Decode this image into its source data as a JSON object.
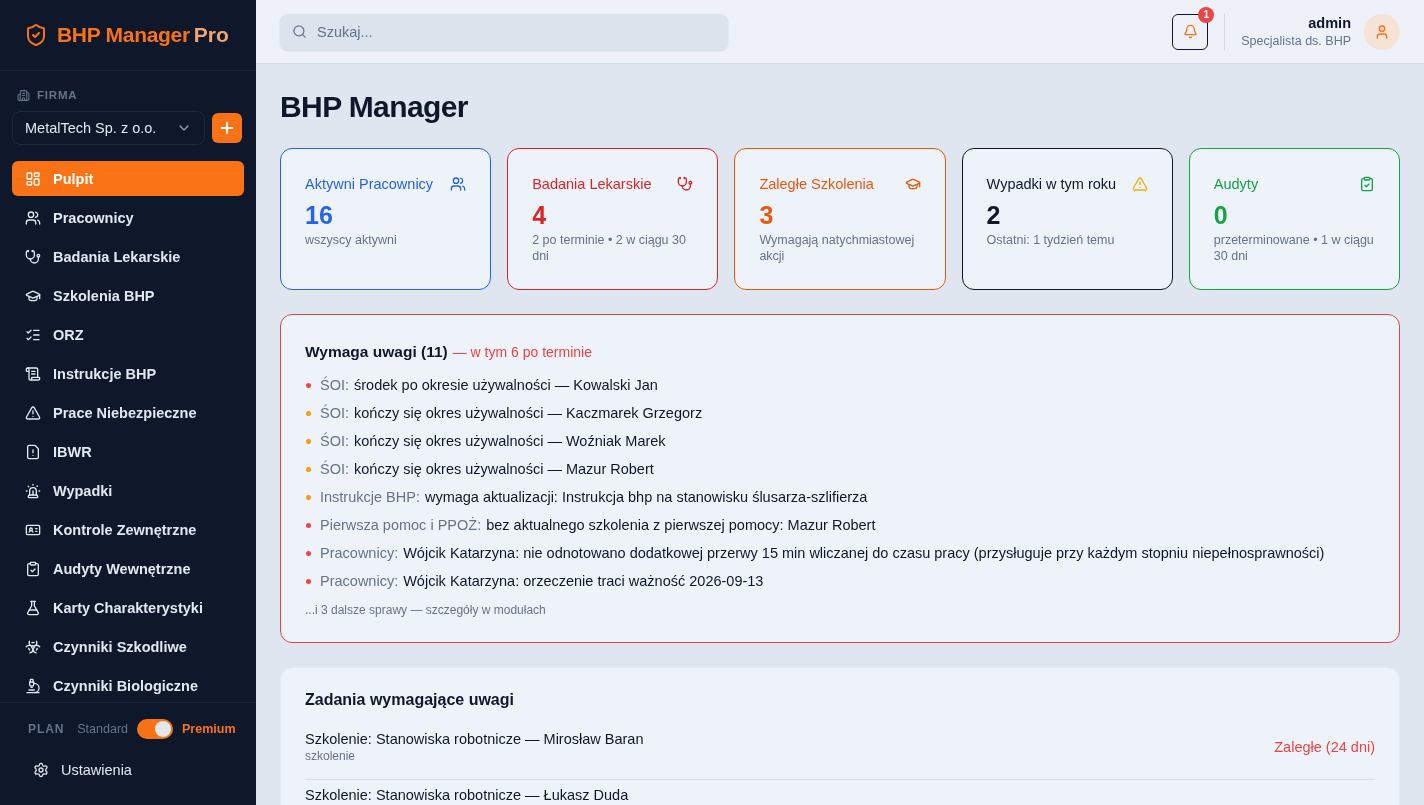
{
  "sidebar": {
    "logo": {
      "name": "BHP Manager",
      "badge": "Pro"
    },
    "company": {
      "label": "FIRMA",
      "value": "MetalTech Sp. z o.o."
    },
    "nav": [
      {
        "label": "Pulpit",
        "selected": true
      },
      {
        "label": "Pracownicy",
        "selected": false
      },
      {
        "label": "Badania Lekarskie",
        "selected": false
      },
      {
        "label": "Szkolenia BHP",
        "selected": false
      },
      {
        "label": "ORZ",
        "selected": false
      },
      {
        "label": "Instrukcje BHP",
        "selected": false
      },
      {
        "label": "Prace Niebezpieczne",
        "selected": false
      },
      {
        "label": "IBWR",
        "selected": false
      },
      {
        "label": "Wypadki",
        "selected": false
      },
      {
        "label": "Kontrole Zewnętrzne",
        "selected": false
      },
      {
        "label": "Audyty Wewnętrzne",
        "selected": false
      },
      {
        "label": "Karty Charakterystyki",
        "selected": false
      },
      {
        "label": "Czynniki Szkodliwe",
        "selected": false
      },
      {
        "label": "Czynniki Biologiczne",
        "selected": false
      }
    ],
    "plan": {
      "label": "PLAN",
      "options": [
        "Standard",
        "Premium"
      ],
      "on": true
    },
    "settings": {
      "label": "Ustawienia"
    }
  },
  "topbar": {
    "search": {
      "placeholder": "Szukaj..."
    },
    "notifications": {
      "count": "1"
    },
    "user": {
      "name": "admin",
      "role": "Specjalista ds. BHP"
    }
  },
  "page_title": "BHP Manager",
  "cards": [
    {
      "title": "Aktywni Pracownicy",
      "value": "16",
      "note": "wszyscy aktywni",
      "color": "#2563eb"
    },
    {
      "title": "Badania Lekarskie",
      "value": "4",
      "note": "2 po terminie • 2 w ciągu 30 dni",
      "color": "#dc2626"
    },
    {
      "title": "Zaległe Szkolenia",
      "value": "3",
      "note": "Wymagają natychmiastowej akcji",
      "color": "#ea580c"
    },
    {
      "title": "Wypadki w tym roku",
      "value": "2",
      "note": "Ostatni: 1 tydzień temu",
      "color": "#0f172a"
    },
    {
      "title": "Audyty",
      "value": "0",
      "note": "przeterminowane • 1 w ciągu 30 dni",
      "color": "#16a34a"
    }
  ],
  "attention": {
    "title": "Wymaga uwagi (11)",
    "subtitle": "— w tym 6 po terminie",
    "items": [
      {
        "category": "ŚOI:",
        "text": "środek po okresie używalności — Kowalski Jan",
        "color": "#ef4444"
      },
      {
        "category": "ŚOI:",
        "text": "kończy się okres używalności — Kaczmarek Grzegorz",
        "color": "#f59e0b"
      },
      {
        "category": "ŚOI:",
        "text": "kończy się okres używalności — Woźniak Marek",
        "color": "#f59e0b"
      },
      {
        "category": "ŚOI:",
        "text": "kończy się okres używalności — Mazur Robert",
        "color": "#f59e0b"
      },
      {
        "category": "Instrukcje BHP:",
        "text": "wymaga aktualizacji: Instrukcja bhp na stanowisku ślusarza-szlifierza",
        "color": "#f59e0b"
      },
      {
        "category": "Pierwsza pomoc i PPOŻ:",
        "text": "bez aktualnego szkolenia z pierwszej pomocy: Mazur Robert",
        "color": "#ef4444"
      },
      {
        "category": "Pracownicy:",
        "text": "Wójcik Katarzyna: nie odnotowano dodatkowej przerwy 15 min wliczanej do czasu pracy (przysługuje przy każdym stopniu niepełnosprawności)",
        "color": "#ef4444"
      },
      {
        "category": "Pracownicy:",
        "text": "Wójcik Katarzyna: orzeczenie traci ważność 2026-09-13",
        "color": "#ef4444"
      }
    ],
    "more": "...i 3 dalsze sprawy — szczegóły w modułach"
  },
  "tasks": {
    "title": "Zadania wymagające uwagi",
    "rows": [
      {
        "title": "Szkolenie: Stanowiska robotnicze — Mirosław Baran",
        "type": "szkolenie",
        "status": "Zaległe (24 dni)"
      },
      {
        "title": "Szkolenie: Stanowiska robotnicze — Łukasz Duda"
      }
    ]
  }
}
